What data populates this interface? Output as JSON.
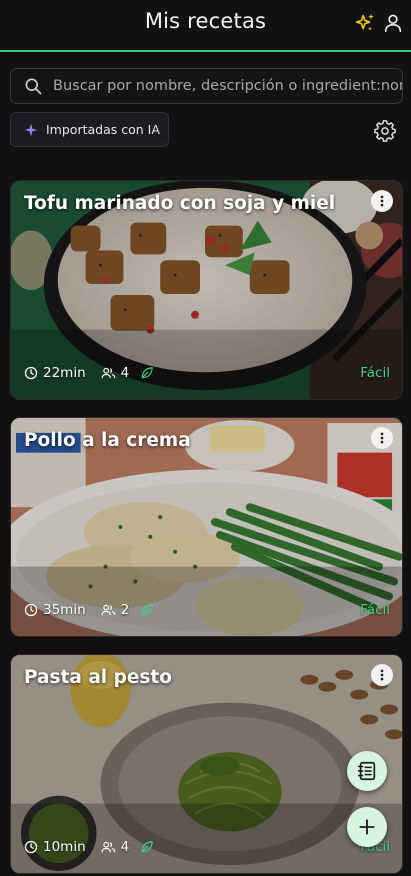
{
  "header": {
    "title": "Mis recetas",
    "icons": [
      "ai-sparkles-icon",
      "user-icon"
    ]
  },
  "search": {
    "placeholder": "Buscar por nombre, descripción o ingredient:nor",
    "value": ""
  },
  "filter_chip": {
    "label": "Importadas con IA",
    "icon": "ai-sparkles-icon"
  },
  "settings_icon": "gear-icon",
  "recipes": [
    {
      "title": "Tofu marinado con soja y miel",
      "time": "22min",
      "servings": "4",
      "difficulty": "Fácil",
      "tag_icon": "leaf-icon"
    },
    {
      "title": "Pollo a la crema",
      "time": "35min",
      "servings": "2",
      "difficulty": "Fácil",
      "tag_icon": "leaf-icon"
    },
    {
      "title": "Pasta al pesto",
      "time": "10min",
      "servings": "4",
      "difficulty": "Fácil",
      "tag_icon": "leaf-icon"
    }
  ],
  "fabs": [
    "recipe-book-icon",
    "add-icon"
  ],
  "colors": {
    "accent": "#34c77b",
    "background": "#111111",
    "ai_sparkle": "#f5c518",
    "fab_background": "#d5f5e2"
  }
}
